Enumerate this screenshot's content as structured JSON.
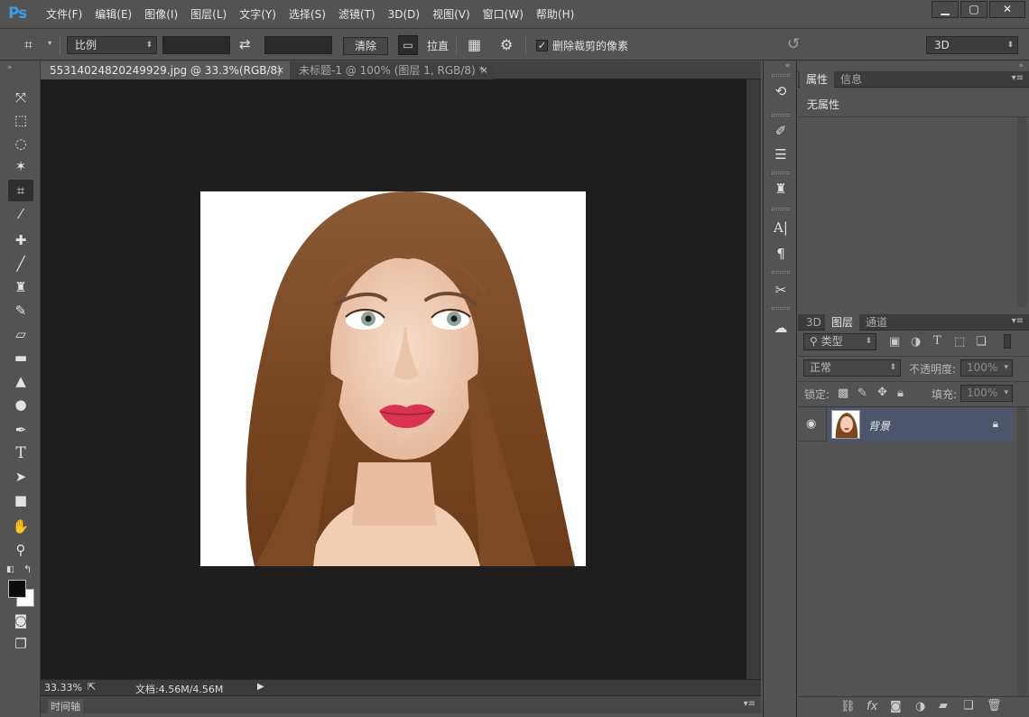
{
  "app": {
    "logo": "Ps"
  },
  "menu": [
    "文件(F)",
    "编辑(E)",
    "图像(I)",
    "图层(L)",
    "文字(Y)",
    "选择(S)",
    "滤镜(T)",
    "3D(D)",
    "视图(V)",
    "窗口(W)",
    "帮助(H)"
  ],
  "options": {
    "ratio_select": "比例",
    "clear_button": "清除",
    "straighten_label": "拉直",
    "delete_cropped_label": "删除裁剪的像素",
    "delete_cropped_checked": true,
    "workspace_select": "3D"
  },
  "tabs": [
    {
      "title": "55314024820249929.jpg @ 33.3%(RGB/8) *",
      "active": true
    },
    {
      "title": "未标题-1 @ 100% (图层 1, RGB/8) *",
      "active": false
    }
  ],
  "status": {
    "zoom": "33.33%",
    "doc": "文档:4.56M/4.56M"
  },
  "timeline_label": "时间轴",
  "properties_panel": {
    "tab_properties": "属性",
    "tab_info": "信息",
    "content": "无属性"
  },
  "layers_panel": {
    "tab_3d": "3D",
    "tab_layers": "图层",
    "tab_channels": "通道",
    "filter_kind": "类型",
    "blend_mode": "正常",
    "opacity_label": "不透明度:",
    "opacity_value": "100%",
    "lock_label": "锁定:",
    "fill_label": "填充:",
    "fill_value": "100%",
    "layers": [
      {
        "name": "背景",
        "visible": true,
        "locked": true
      }
    ]
  },
  "colors": {
    "accent": "#3d9be9",
    "selected_layer": "#4c556c",
    "lips": "#d9344f"
  }
}
